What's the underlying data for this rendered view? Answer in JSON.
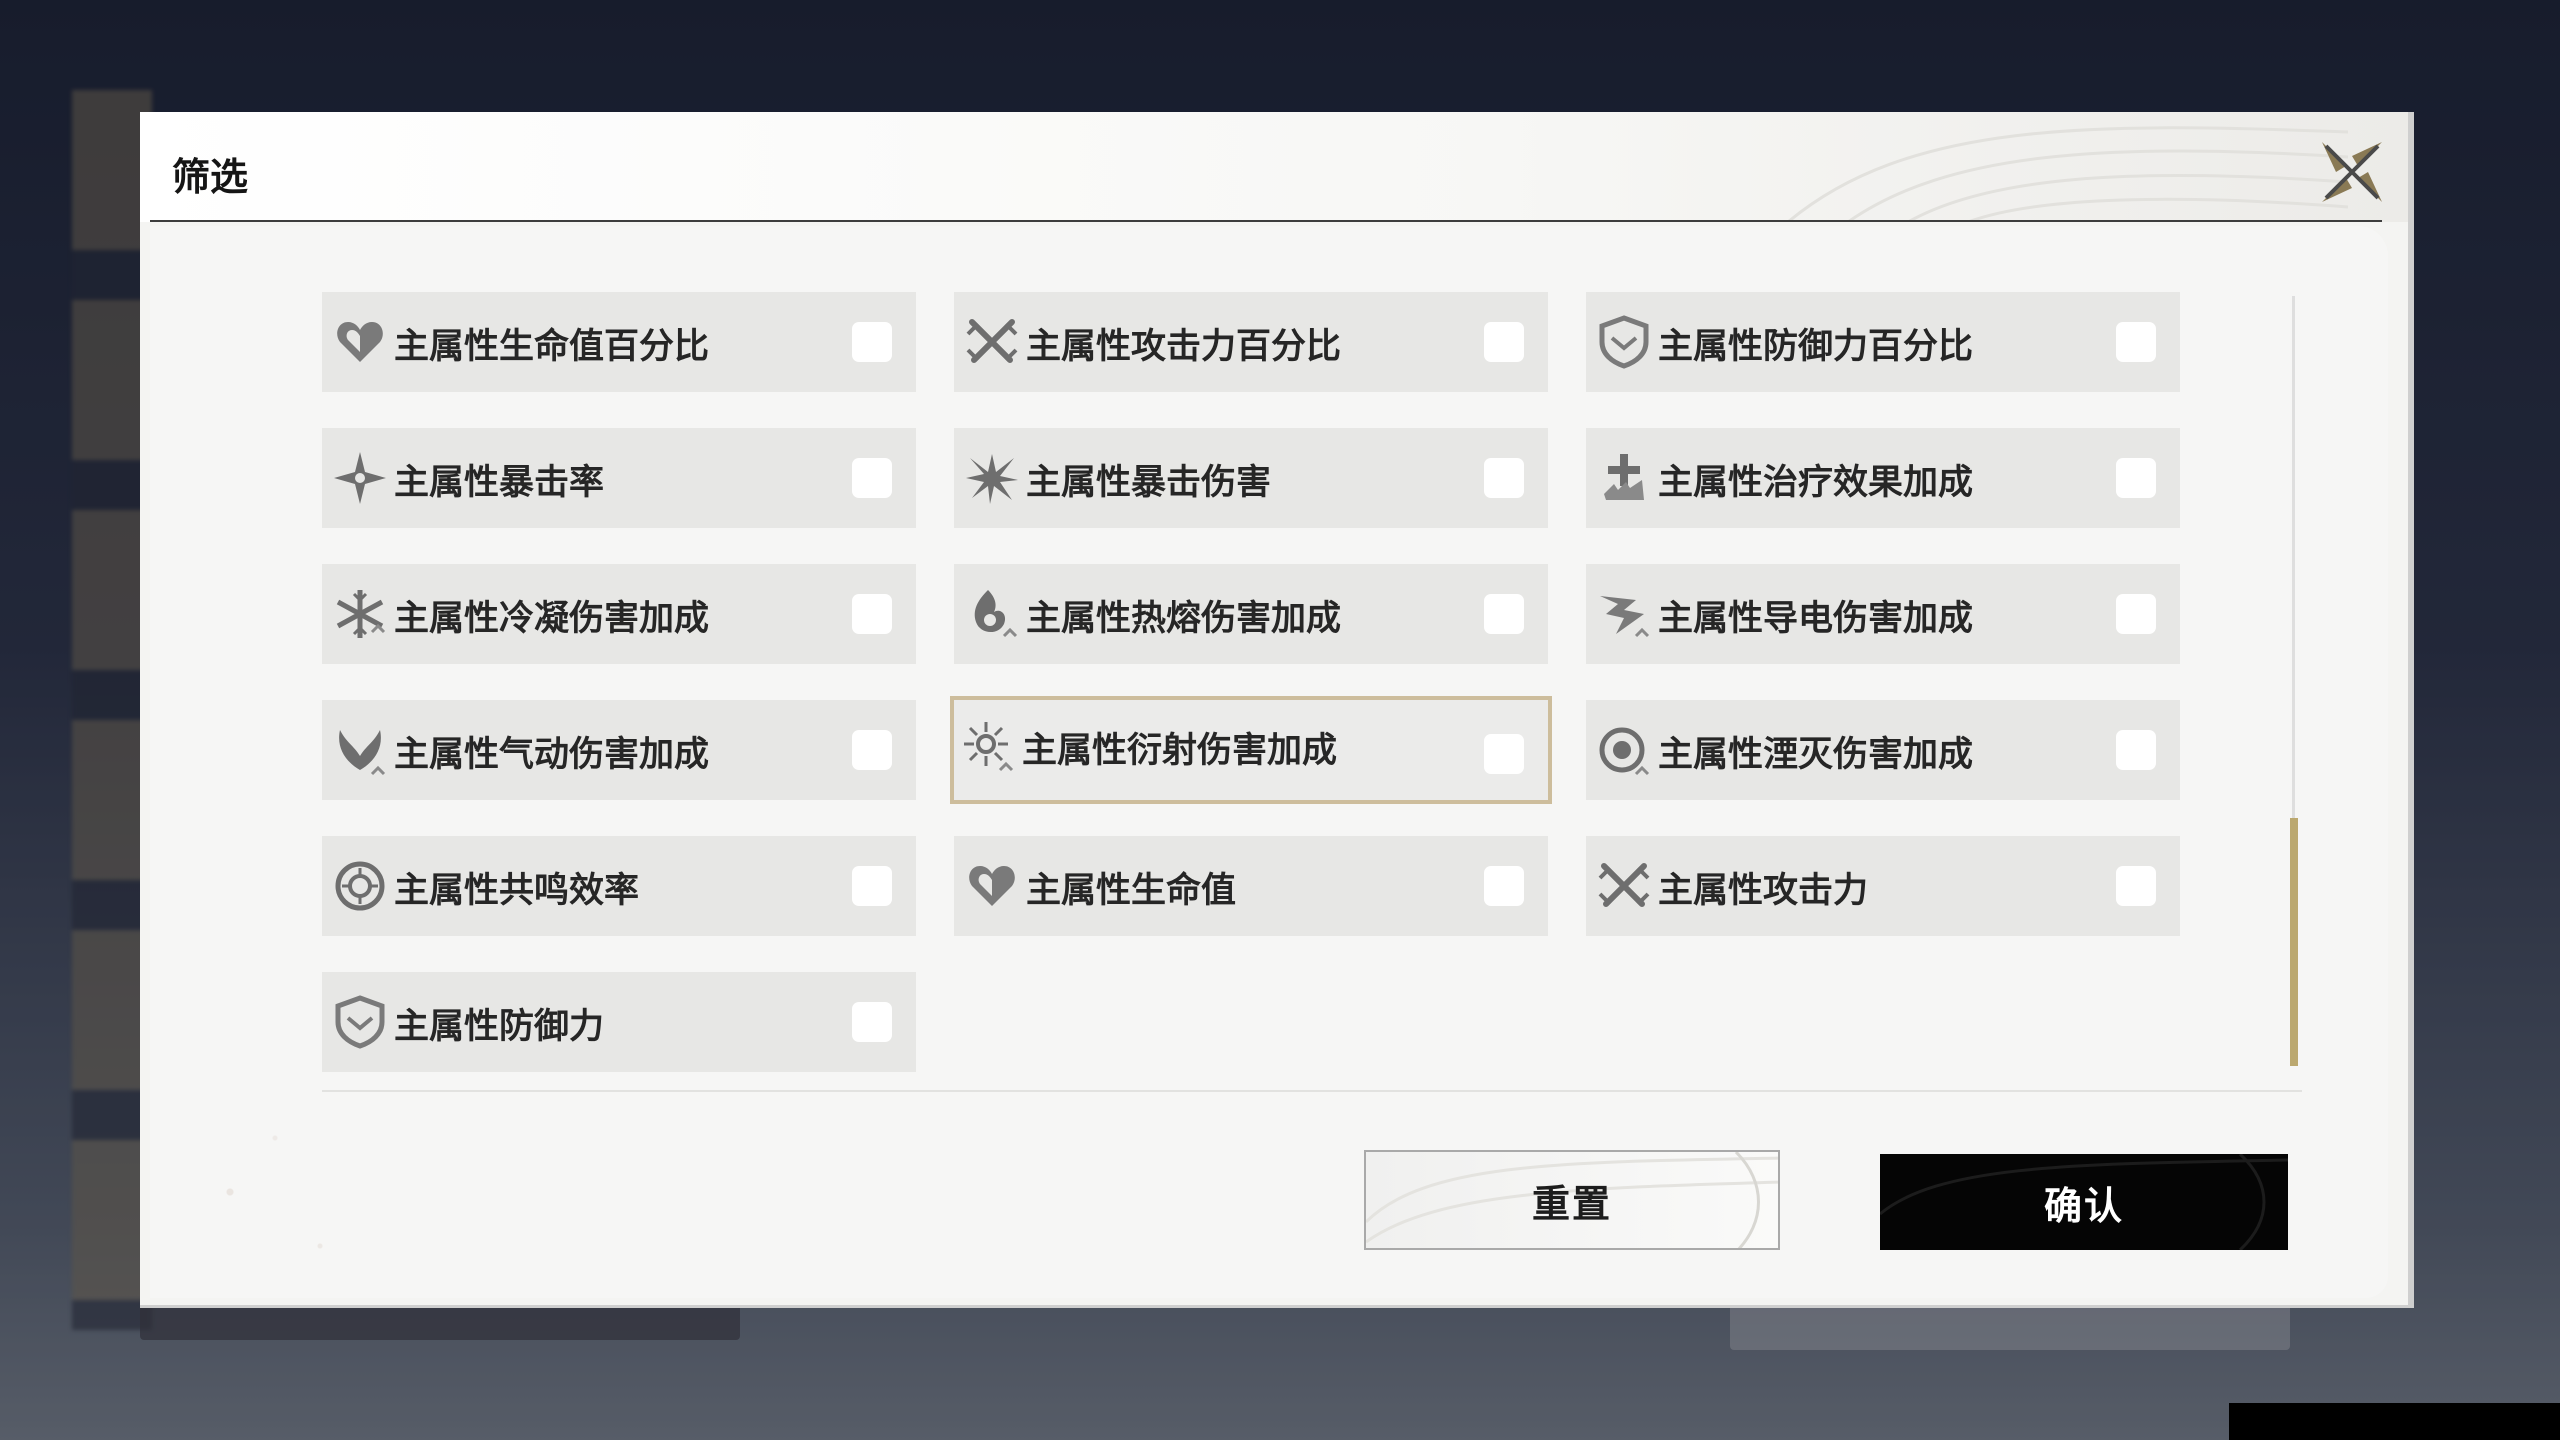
{
  "dialog": {
    "title": "筛选",
    "close_icon": "close-x-icon"
  },
  "options": [
    {
      "label": "主属性生命值百分比",
      "icon": "heart-icon",
      "checked": false,
      "focused": false
    },
    {
      "label": "主属性攻击力百分比",
      "icon": "crossed-swords-icon",
      "checked": false,
      "focused": false
    },
    {
      "label": "主属性防御力百分比",
      "icon": "shield-icon",
      "checked": false,
      "focused": false
    },
    {
      "label": "主属性暴击率",
      "icon": "crit-star-icon",
      "checked": false,
      "focused": false
    },
    {
      "label": "主属性暴击伤害",
      "icon": "crit-burst-icon",
      "checked": false,
      "focused": false
    },
    {
      "label": "主属性治疗效果加成",
      "icon": "healing-icon",
      "checked": false,
      "focused": false
    },
    {
      "label": "主属性冷凝伤害加成",
      "icon": "snowflake-icon",
      "checked": false,
      "focused": false
    },
    {
      "label": "主属性热熔伤害加成",
      "icon": "flame-icon",
      "checked": false,
      "focused": false
    },
    {
      "label": "主属性导电伤害加成",
      "icon": "lightning-icon",
      "checked": false,
      "focused": false
    },
    {
      "label": "主属性气动伤害加成",
      "icon": "wind-icon",
      "checked": false,
      "focused": false
    },
    {
      "label": "主属性衍射伤害加成",
      "icon": "sun-icon",
      "checked": false,
      "focused": true
    },
    {
      "label": "主属性湮灭伤害加成",
      "icon": "vortex-icon",
      "checked": false,
      "focused": false
    },
    {
      "label": "主属性共鸣效率",
      "icon": "resonance-icon",
      "checked": false,
      "focused": false
    },
    {
      "label": "主属性生命值",
      "icon": "heart-icon",
      "checked": false,
      "focused": false
    },
    {
      "label": "主属性攻击力",
      "icon": "crossed-swords-icon",
      "checked": false,
      "focused": false
    },
    {
      "label": "主属性防御力",
      "icon": "shield-icon",
      "checked": false,
      "focused": false
    }
  ],
  "buttons": {
    "reset": "重置",
    "confirm": "确认"
  },
  "colors": {
    "accent_gold": "#bba86f",
    "selected_border": "#cdbd9c",
    "confirm_bg": "#050505",
    "icon_gray": "#707070"
  }
}
